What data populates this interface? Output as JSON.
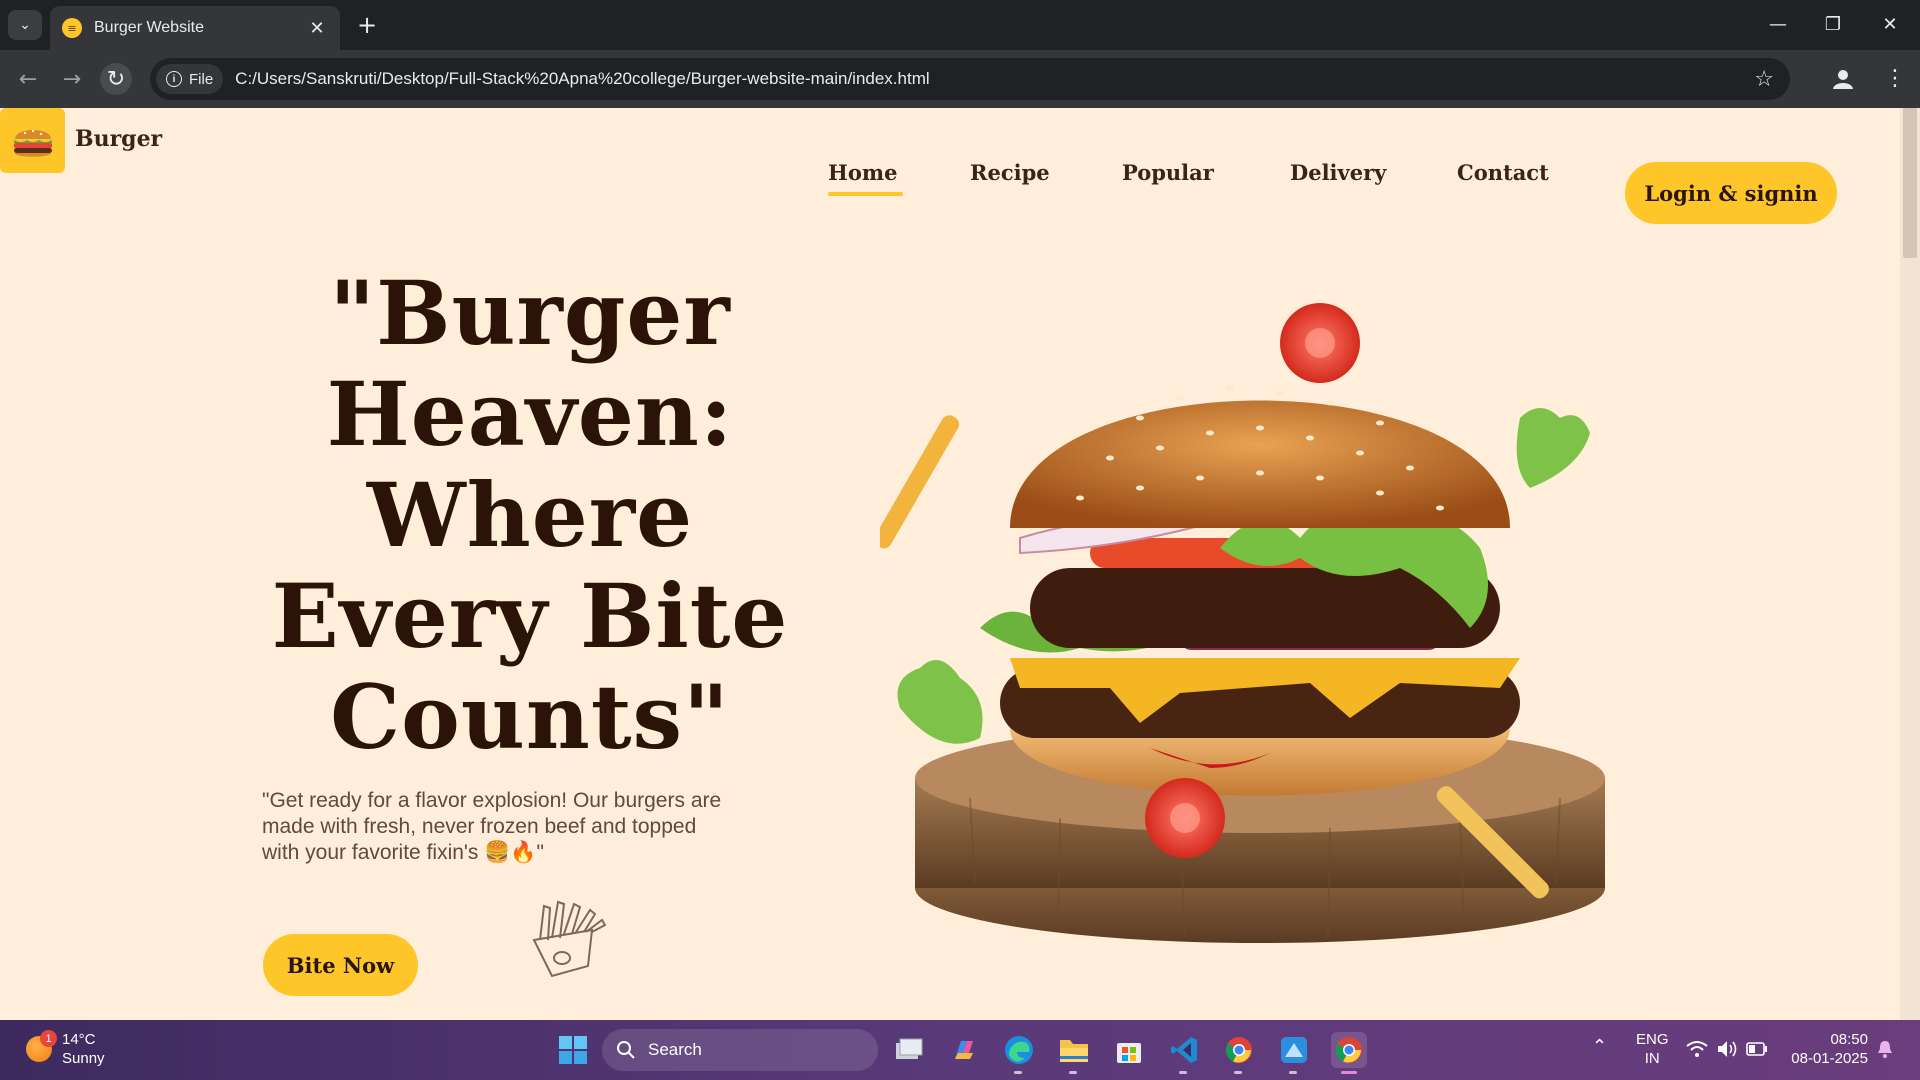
{
  "browser": {
    "tab_title": "Burger Website",
    "chip_label": "File",
    "url": "C:/Users/Sanskruti/Desktop/Full-Stack%20Apna%20college/Burger-website-main/index.html"
  },
  "site": {
    "brand": "Burger",
    "nav": [
      "Home",
      "Recipe",
      "Popular",
      "Delivery",
      "Contact"
    ],
    "login_label": "Login & signin",
    "headline": "\"Burger Heaven: Where Every Bite Counts\"",
    "subtext": "\"Get ready for a flavor explosion! Our burgers are made with fresh, never frozen beef and topped with your favorite fixin's 🍔🔥\"",
    "cta_label": "Bite Now"
  },
  "taskbar": {
    "weather_temp": "14°C",
    "weather_desc": "Sunny",
    "weather_badge": "1",
    "search_label": "Search",
    "lang_top": "ENG",
    "lang_bottom": "IN",
    "time": "08:50",
    "date": "08-01-2025"
  },
  "colors": {
    "accent": "#fec629",
    "page_bg": "#ffeed9",
    "heading": "#2b1407"
  }
}
